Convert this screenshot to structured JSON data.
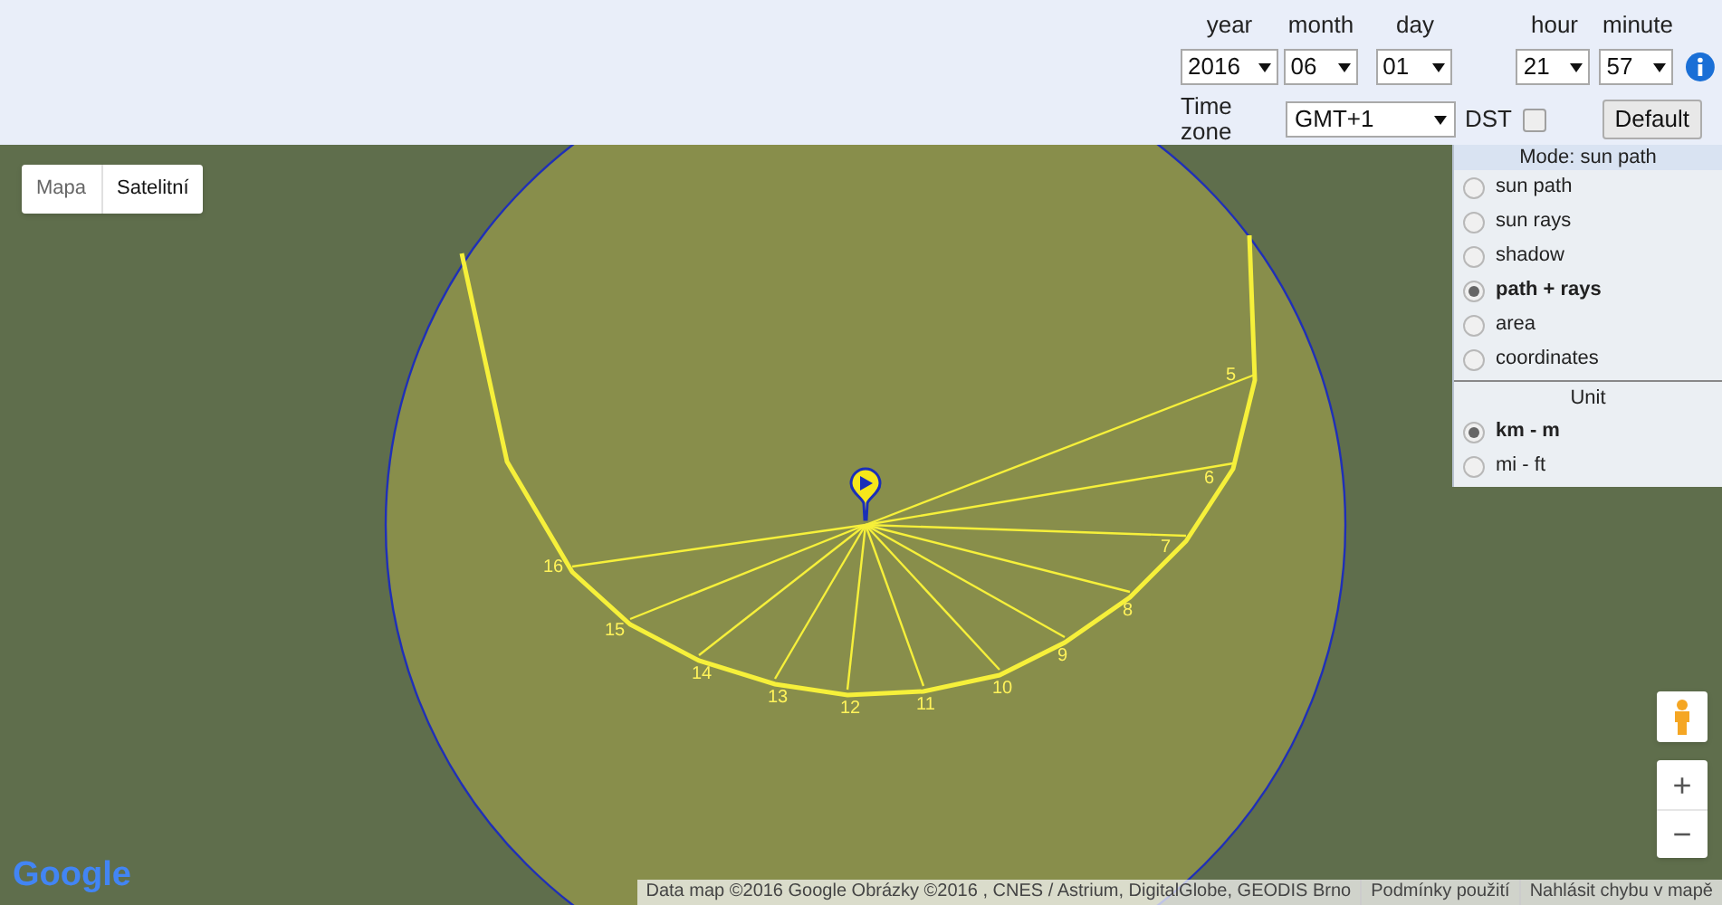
{
  "date_time": {
    "fields": [
      {
        "kind": "year",
        "label": "year",
        "value": "2016"
      },
      {
        "kind": "month",
        "label": "month",
        "value": "06"
      },
      {
        "kind": "day",
        "label": "day",
        "value": "01"
      },
      {
        "kind": "hour",
        "label": "hour",
        "value": "21"
      },
      {
        "kind": "minute",
        "label": "minute",
        "value": "57"
      }
    ],
    "timezone": {
      "label": "Time zone",
      "value": "GMT+1"
    },
    "dst": {
      "label": "DST",
      "checked": false
    },
    "default_button": "Default"
  },
  "map_type": [
    {
      "label": "Mapa",
      "selected": false
    },
    {
      "label": "Satelitní",
      "selected": true
    }
  ],
  "mode_panel": {
    "title": "Mode: sun path",
    "options": [
      {
        "label": "sun path",
        "selected": false
      },
      {
        "label": "sun rays",
        "selected": false
      },
      {
        "label": "shadow",
        "selected": false
      },
      {
        "label": "path + rays",
        "selected": true
      },
      {
        "label": "area",
        "selected": false
      },
      {
        "label": "coordinates",
        "selected": false
      }
    ]
  },
  "unit_panel": {
    "title": "Unit",
    "options": [
      {
        "label": "km - m",
        "selected": true
      },
      {
        "label": "mi - ft",
        "selected": false
      }
    ]
  },
  "sun_path": {
    "hours": [
      "16",
      "15",
      "14",
      "13",
      "12",
      "11",
      "10",
      "9",
      "8",
      "7",
      "6",
      "5"
    ]
  },
  "zoom": {
    "in": "+",
    "out": "−"
  },
  "logo": "Google",
  "attribution": [
    "Data map ©2016 Google Obrázky ©2016 , CNES / Astrium, DigitalGlobe, GEODIS Brno",
    "Podmínky použití",
    "Nahlásit chybu v mapě"
  ]
}
